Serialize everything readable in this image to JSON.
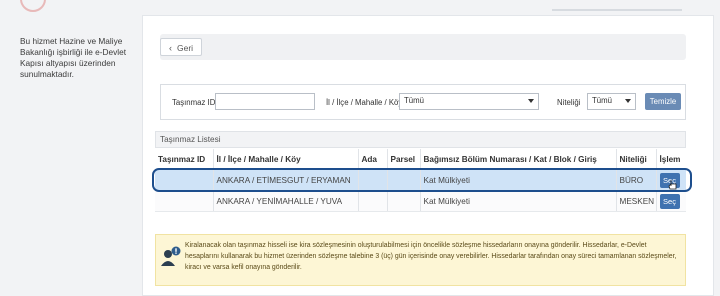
{
  "sidebar": {
    "info_text": "Bu hizmet Hazine ve Maliye Bakanlığı işbirliği ile e-Devlet Kapısı altyapısı üzerinden sunulmaktadır."
  },
  "back_button": {
    "label": "Geri"
  },
  "filters": {
    "tasinmaz_id_label": "Taşınmaz ID",
    "tasinmaz_id_value": "",
    "location_label": "İl / İlçe / Mahalle / Köy",
    "location_value": "Tümü",
    "niteligi_label": "Niteliği",
    "niteligi_value": "Tümü",
    "clear_label": "Temizle"
  },
  "list": {
    "title": "Taşınmaz Listesi",
    "columns": [
      "Taşınmaz ID",
      "İl / İlçe / Mahalle / Köy",
      "Ada",
      "Parsel",
      "Bağımsız Bölüm Numarası / Kat / Blok / Giriş",
      "Niteliği",
      "İşlem"
    ],
    "rows": [
      {
        "id": "",
        "location": "ANKARA / ETİMESGUT / ERYAMAN",
        "ada": "",
        "parsel": "",
        "bolum": "Kat Mülkiyeti",
        "nitelik": "BÜRO",
        "action": "Seç",
        "selected": true
      },
      {
        "id": "",
        "location": "ANKARA / YENİMAHALLE / YUVA",
        "ada": "",
        "parsel": "",
        "bolum": "Kat Mülkiyeti",
        "nitelik": "MESKEN",
        "action": "Seç",
        "selected": false
      }
    ]
  },
  "notice": {
    "icon": "user-alert-icon",
    "text": "Kiralanacak olan taşınmaz hisseli ise kira sözleşmesinin oluşturulabilmesi için öncelikle sözleşme hissedarların onayına gönderilir. Hissedarlar, e-Devlet hesaplarını kullanarak bu hizmet üzerinden sözleşme talebine 3 (üç) gün içerisinde onay verebilirler. Hissedarlar tarafından onay süreci tamamlanan sözleşmeler, kiracı ve varsa kefil onayına gönderilir."
  },
  "colors": {
    "primary_button": "#3f72b0",
    "clear_button": "#6a8bb5",
    "selected_row": "#cfe3f7",
    "highlight_ring": "#1d4e8d",
    "notice_bg": "#fdf6d5"
  }
}
